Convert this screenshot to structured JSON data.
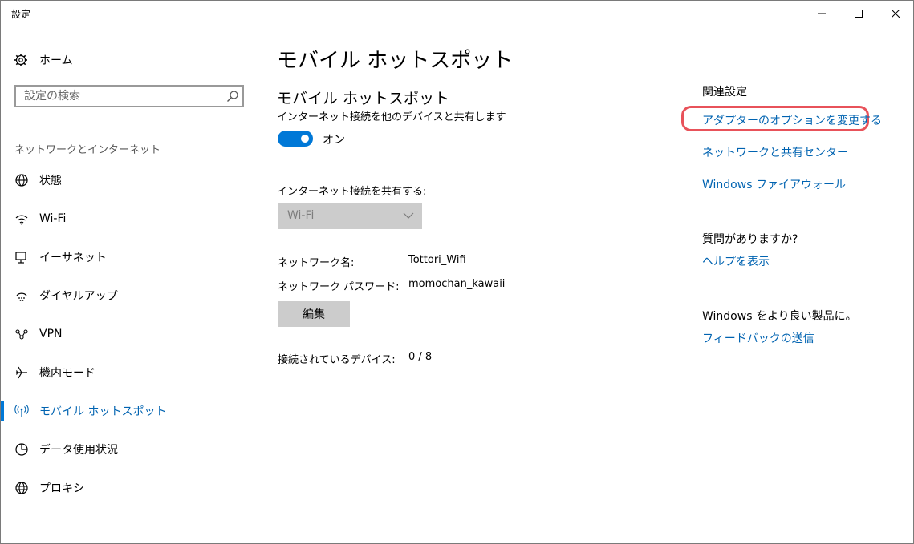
{
  "window": {
    "title": "設定"
  },
  "sidebar": {
    "home_label": "ホーム",
    "search_placeholder": "設定の検索",
    "section_label": "ネットワークとインターネット",
    "items": [
      {
        "label": "状態",
        "icon": "globe-status-icon"
      },
      {
        "label": "Wi-Fi",
        "icon": "wifi-icon"
      },
      {
        "label": "イーサネット",
        "icon": "ethernet-icon"
      },
      {
        "label": "ダイヤルアップ",
        "icon": "dialup-icon"
      },
      {
        "label": "VPN",
        "icon": "vpn-icon"
      },
      {
        "label": "機内モード",
        "icon": "airplane-icon"
      },
      {
        "label": "モバイル ホットスポット",
        "icon": "hotspot-icon",
        "active": true
      },
      {
        "label": "データ使用状況",
        "icon": "data-usage-icon"
      },
      {
        "label": "プロキシ",
        "icon": "proxy-globe-icon"
      }
    ]
  },
  "main": {
    "page_title": "モバイル ホットスポット",
    "section_title": "モバイル ホットスポット",
    "section_desc": "インターネット接続を他のデバイスと共有します",
    "toggle_label": "オン",
    "share_label": "インターネット接続を共有する:",
    "share_value": "Wi-Fi",
    "network_name_label": "ネットワーク名:",
    "network_name_value": "Tottori_Wifi",
    "password_label": "ネットワーク パスワード:",
    "password_value": "momochan_kawaii",
    "edit_label": "編集",
    "devices_label": "接続されているデバイス:",
    "devices_value": "0 / 8"
  },
  "related": {
    "heading": "関連設定",
    "links": [
      "アダプターのオプションを変更する",
      "ネットワークと共有センター",
      "Windows ファイアウォール"
    ],
    "question_heading": "質問がありますか?",
    "help_link": "ヘルプを表示",
    "feedback_heading": "Windows をより良い製品に。",
    "feedback_link": "フィードバックの送信"
  },
  "colors": {
    "accent": "#0078d7",
    "link": "#0063b1",
    "highlight": "#e8525a"
  }
}
